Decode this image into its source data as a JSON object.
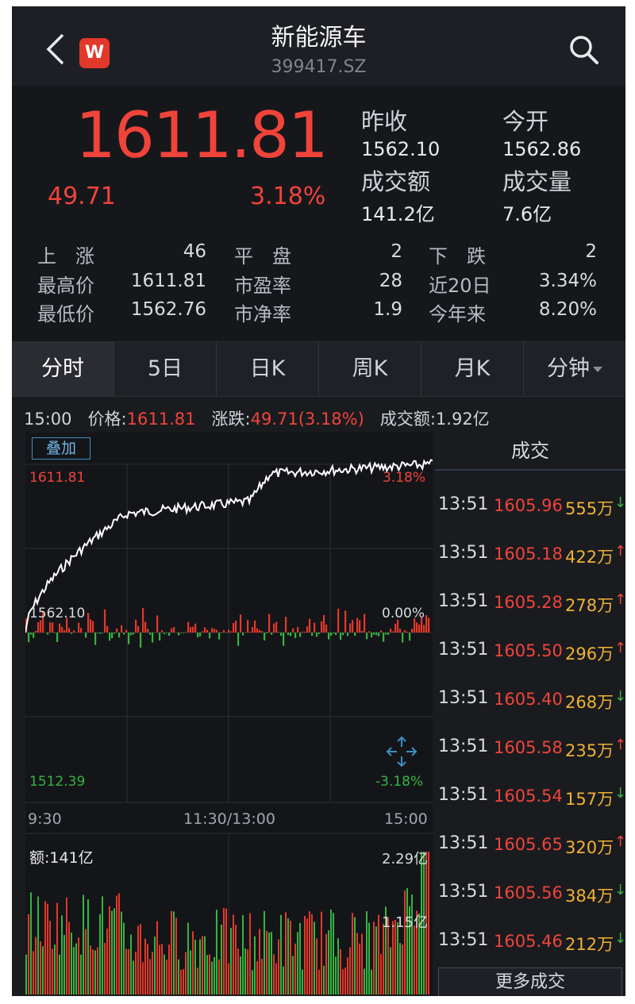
{
  "header": {
    "title": "新能源车",
    "code": "399417.SZ",
    "logo_text": "W",
    "back_icon": "chevron-left-icon",
    "search_icon": "search-icon"
  },
  "quote": {
    "price": "1611.81",
    "change": "49.71",
    "change_pct": "3.18%",
    "fields": [
      {
        "label": "昨收",
        "value": "1562.10"
      },
      {
        "label": "今开",
        "value": "1562.86"
      },
      {
        "label": "成交额",
        "value": "141.2亿"
      },
      {
        "label": "成交量",
        "value": "7.6亿"
      }
    ],
    "stats": [
      [
        {
          "label": "上　涨",
          "value": "46"
        },
        {
          "label": "平　盘",
          "value": "2"
        },
        {
          "label": "下　跌",
          "value": "2"
        }
      ],
      [
        {
          "label": "最高价",
          "value": "1611.81"
        },
        {
          "label": "市盈率",
          "value": "28"
        },
        {
          "label": "近20日",
          "value": "3.34%"
        }
      ],
      [
        {
          "label": "最低价",
          "value": "1562.76"
        },
        {
          "label": "市净率",
          "value": "1.9"
        },
        {
          "label": "今年来",
          "value": "8.20%"
        }
      ]
    ]
  },
  "tabs": [
    "分时",
    "5日",
    "日K",
    "周K",
    "月K",
    "分钟"
  ],
  "info": {
    "time": "15:00",
    "price_label": "价格:",
    "price": "1611.81",
    "change_label": "涨跌:",
    "change": "49.71(3.18%)",
    "amount_label": "成交额:",
    "amount": "1.92亿"
  },
  "chart": {
    "overlay_label": "叠加",
    "top_price": "1611.81",
    "top_pct": "3.18%",
    "base_price": "1562.10",
    "base_pct": "0.00%",
    "low_price": "1512.39",
    "low_pct": "-3.18%",
    "times": [
      "9:30",
      "11:30/13:00",
      "15:00"
    ],
    "vol_title": "额:141亿",
    "vol_max": "2.29亿",
    "vol_mid": "1.15亿",
    "expand_icon": "expand-arrows-icon"
  },
  "trades": {
    "title": "成交",
    "rows": [
      {
        "time": "13:51",
        "price": "1605.96",
        "vol": "555万",
        "dir": "down"
      },
      {
        "time": "13:51",
        "price": "1605.18",
        "vol": "422万",
        "dir": "up"
      },
      {
        "time": "13:51",
        "price": "1605.28",
        "vol": "278万",
        "dir": "up"
      },
      {
        "time": "13:51",
        "price": "1605.50",
        "vol": "296万",
        "dir": "up"
      },
      {
        "time": "13:51",
        "price": "1605.40",
        "vol": "268万",
        "dir": "down"
      },
      {
        "time": "13:51",
        "price": "1605.58",
        "vol": "235万",
        "dir": "up"
      },
      {
        "time": "13:51",
        "price": "1605.54",
        "vol": "157万",
        "dir": "down"
      },
      {
        "time": "13:51",
        "price": "1605.65",
        "vol": "320万",
        "dir": "up"
      },
      {
        "time": "13:51",
        "price": "1605.56",
        "vol": "384万",
        "dir": "down"
      },
      {
        "time": "13:51",
        "price": "1605.46",
        "vol": "212万",
        "dir": "down"
      }
    ],
    "more_label": "更多成交"
  },
  "colors": {
    "up": "#f0443a",
    "down": "#35b441",
    "volume": "#f0b233",
    "background": "#1a1b1f"
  }
}
